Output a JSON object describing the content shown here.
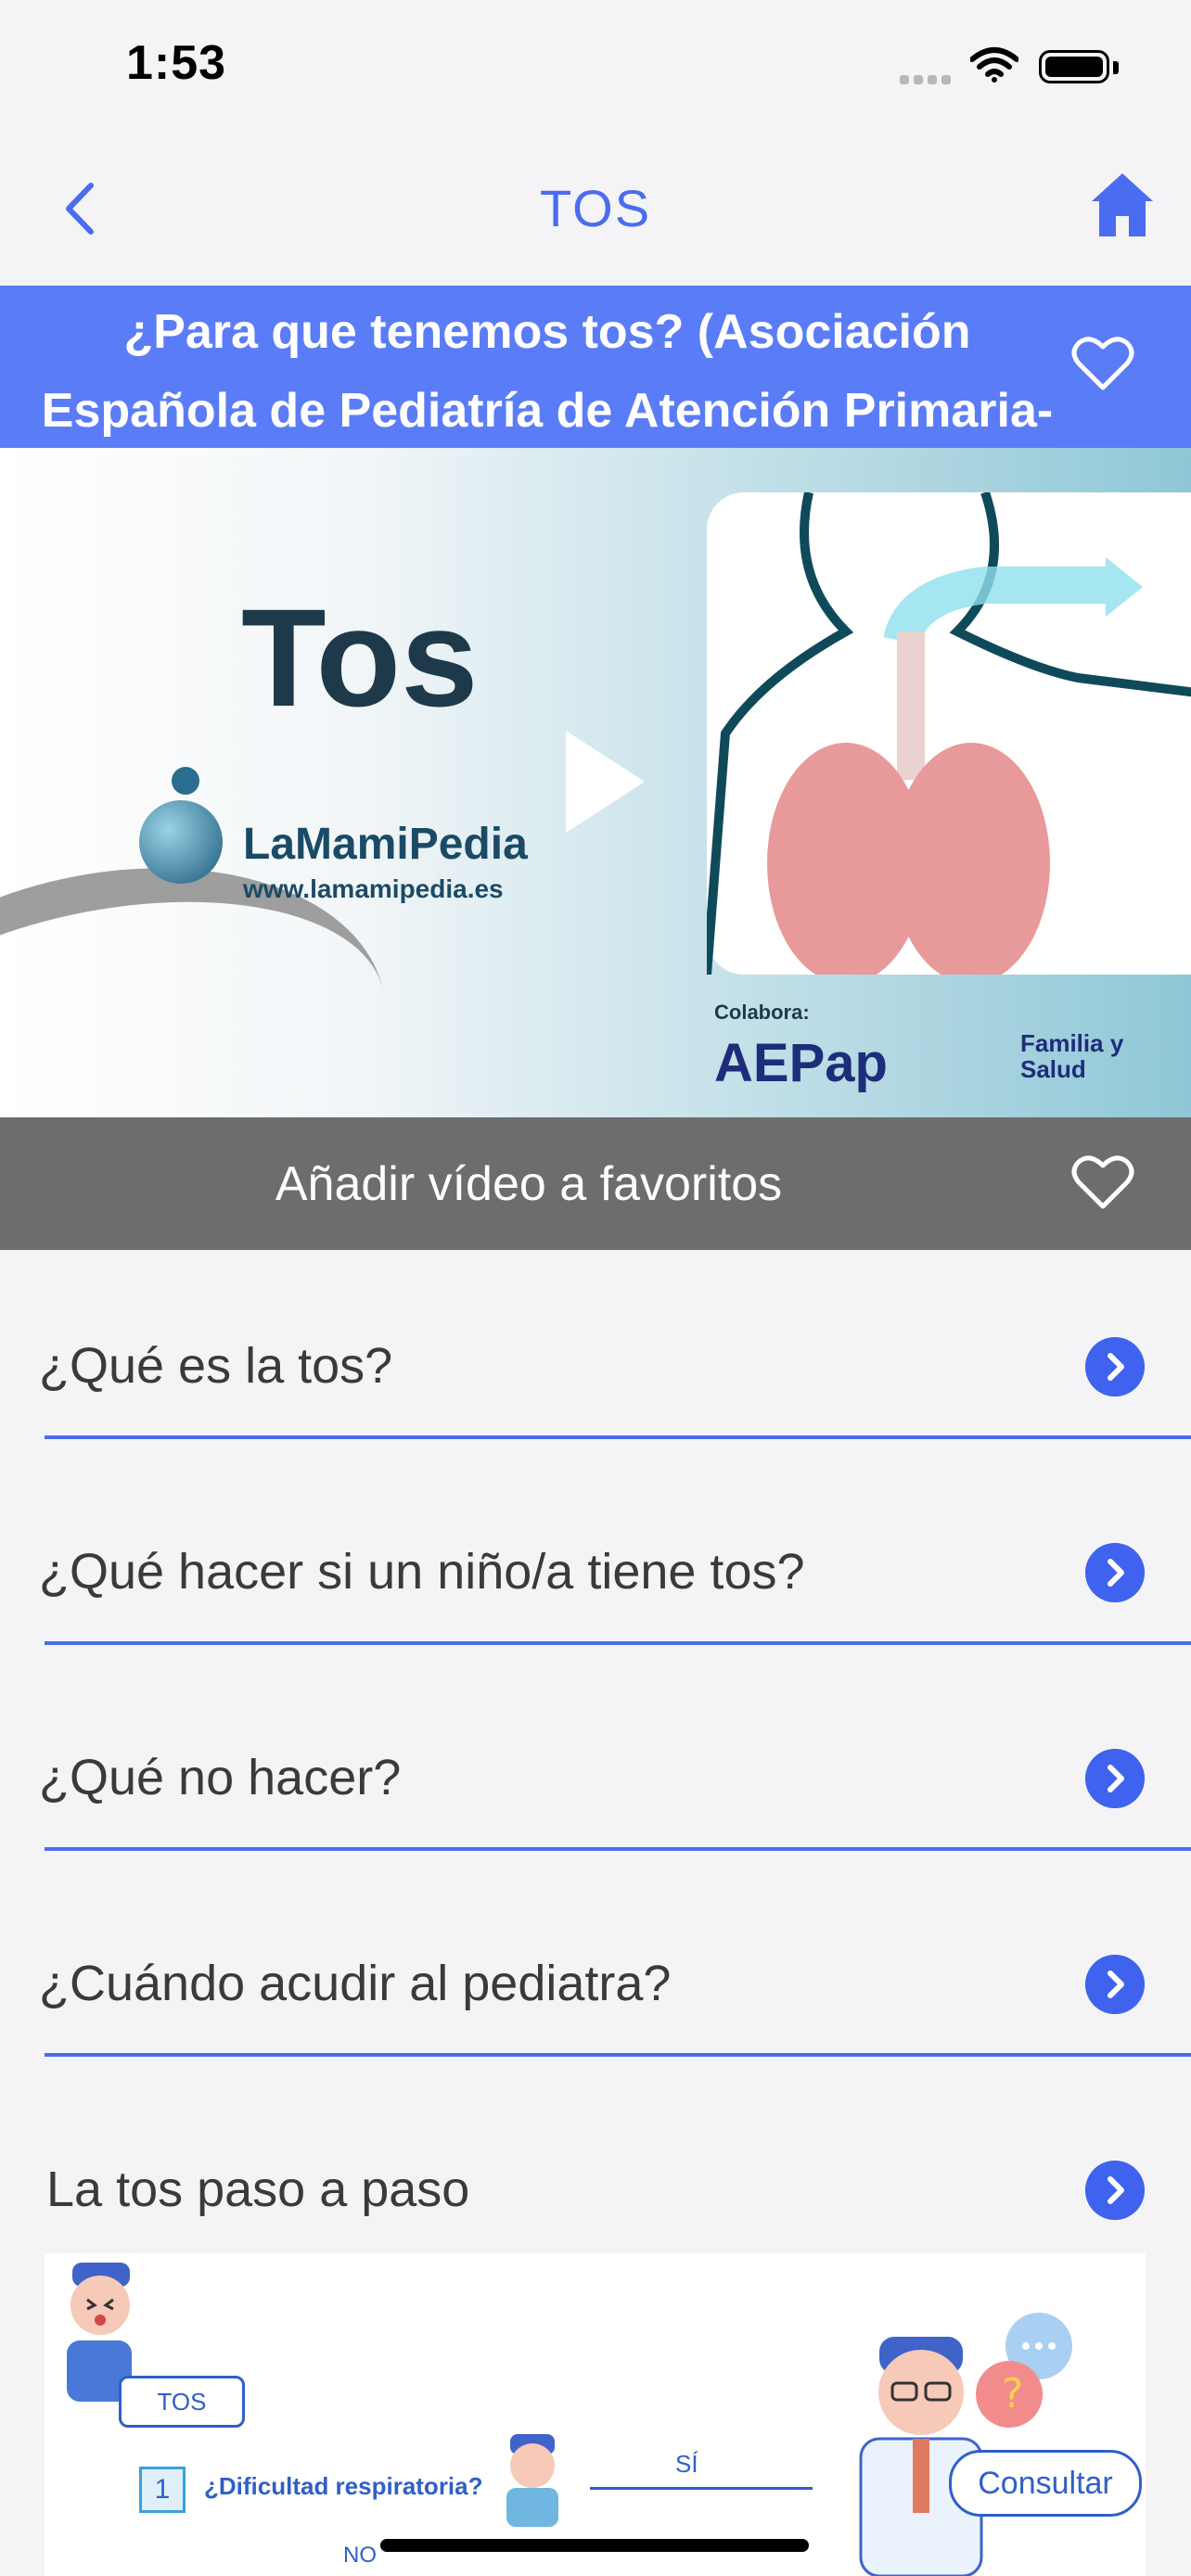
{
  "status_bar": {
    "time": "1:53"
  },
  "nav": {
    "title": "TOS"
  },
  "banner": {
    "title": "¿Para que tenemos tos? (Asociación Española de Pediatría de Atención Primaria-AEPap)"
  },
  "video": {
    "title_text": "Tos",
    "brand": "LaMamiPedia",
    "url": "www.lamamipedia.es",
    "colabora": "Colabora:",
    "partner1": "AEPap",
    "partner2": "Familia y Salud"
  },
  "favorite": {
    "label": "Añadir vídeo a favoritos"
  },
  "list": [
    {
      "label": "¿Qué es la tos?"
    },
    {
      "label": "¿Qué hacer si un niño/a tiene tos?"
    },
    {
      "label": "¿Qué no hacer?"
    },
    {
      "label": "¿Cuándo acudir al pediatra?"
    },
    {
      "label": "La tos paso a paso"
    }
  ],
  "infographic": {
    "tos_label": "TOS",
    "step_number": "1",
    "question": "¿Dificultad respiratoria?",
    "yes": "SÍ",
    "no": "NO",
    "consult": "Consultar"
  },
  "colors": {
    "accent": "#4a6cf0",
    "banner": "#5b7cf7",
    "fav_bar": "#6d6d6d"
  }
}
